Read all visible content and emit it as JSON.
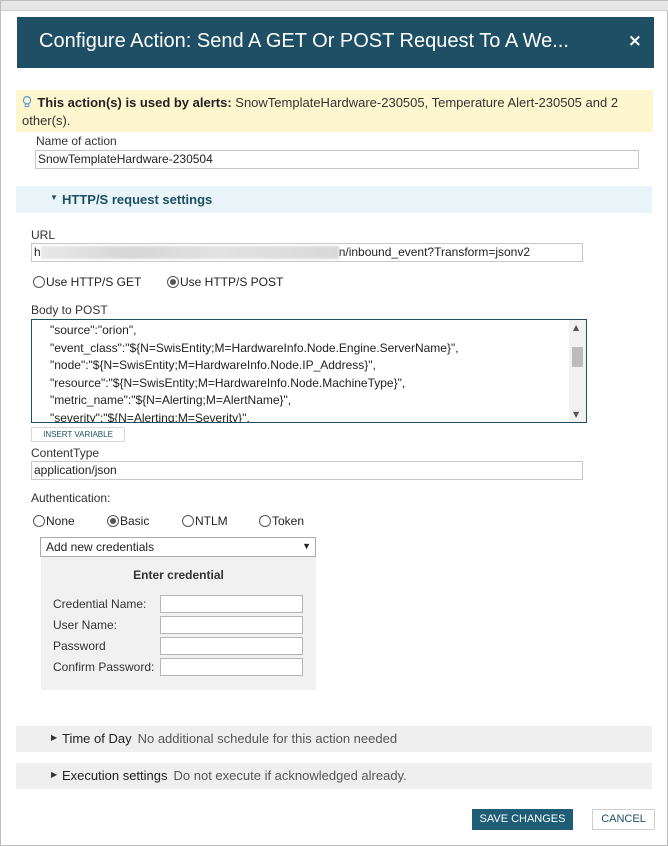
{
  "dialog": {
    "title": "Configure Action: Send A GET Or POST Request To A We...",
    "close_icon": "×"
  },
  "alert_note": {
    "icon": "lightbulb-icon",
    "bold": "This action(s) is used by alerts:",
    "text": " SnowTemplateHardware-230505, Temperature Alert-230505 and 2 other(s)."
  },
  "name_of_action": {
    "label": "Name of action",
    "value": "SnowTemplateHardware-230504"
  },
  "http_section": {
    "title": "HTTP/S request settings",
    "url_label": "URL",
    "url_prefix": "h",
    "url_suffix": "n/inbound_event?Transform=jsonv2",
    "get_label": "Use HTTP/S GET",
    "post_label": "Use HTTP/S POST",
    "selected_method": "POST",
    "body_label": "Body to POST",
    "body_lines": [
      "\"source\":\"orion\",",
      "\"event_class\":\"${N=SwisEntity;M=HardwareInfo.Node.Engine.ServerName}\",",
      "\"node\":\"${N=SwisEntity;M=HardwareInfo.Node.IP_Address}\",",
      "\"resource\":\"${N=SwisEntity;M=HardwareInfo.Node.MachineType}\",",
      "\"metric_name\":\"${N=Alerting;M=AlertName}\",",
      "\"severity\":\"${N=Alerting;M=Severity}\","
    ],
    "insert_variable": "INSERT VARIABLE",
    "content_type_label": "ContentType",
    "content_type_value": "application/json",
    "auth_label": "Authentication:",
    "auth_options": [
      "None",
      "Basic",
      "NTLM",
      "Token"
    ],
    "auth_selected": "Basic",
    "credentials_select": "Add new credentials",
    "credential_panel": {
      "title": "Enter credential",
      "fields": [
        "Credential Name:",
        "User Name:",
        "Password",
        "Confirm Password:"
      ]
    }
  },
  "time_of_day": {
    "title": "Time of Day",
    "desc": "No additional schedule for this action needed"
  },
  "execution": {
    "title": "Execution settings",
    "desc": "Do not execute if acknowledged already."
  },
  "buttons": {
    "save": "SAVE CHANGES",
    "cancel": "CANCEL"
  },
  "colors": {
    "titlebar": "#1e4f65",
    "alert_bg": "#fdf6cf",
    "section_bg": "#e8f4f7",
    "primary_button": "#1e5d75"
  }
}
